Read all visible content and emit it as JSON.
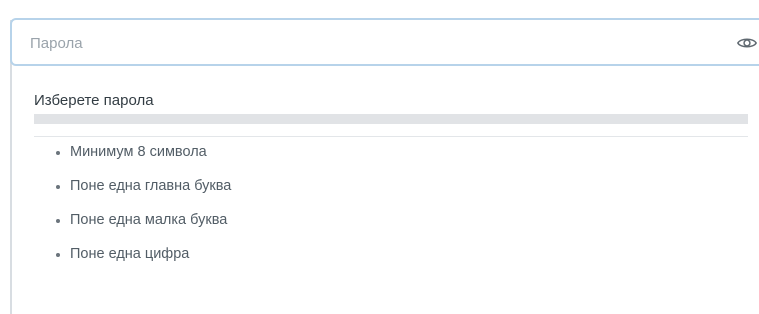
{
  "password_field": {
    "placeholder": "Парола",
    "value": "",
    "toggle_icon": "eye-icon"
  },
  "strength_popover": {
    "title": "Изберете парола",
    "strength_level": 0,
    "rules": [
      {
        "label": "Минимум 8 символа"
      },
      {
        "label": "Поне една главна буква"
      },
      {
        "label": "Поне една малка буква"
      },
      {
        "label": "Поне една цифра"
      }
    ]
  },
  "colors": {
    "field_border": "#b7d3ea",
    "strength_track": "#e1e3e6",
    "text": "#333d44",
    "muted_text": "#525d66"
  }
}
